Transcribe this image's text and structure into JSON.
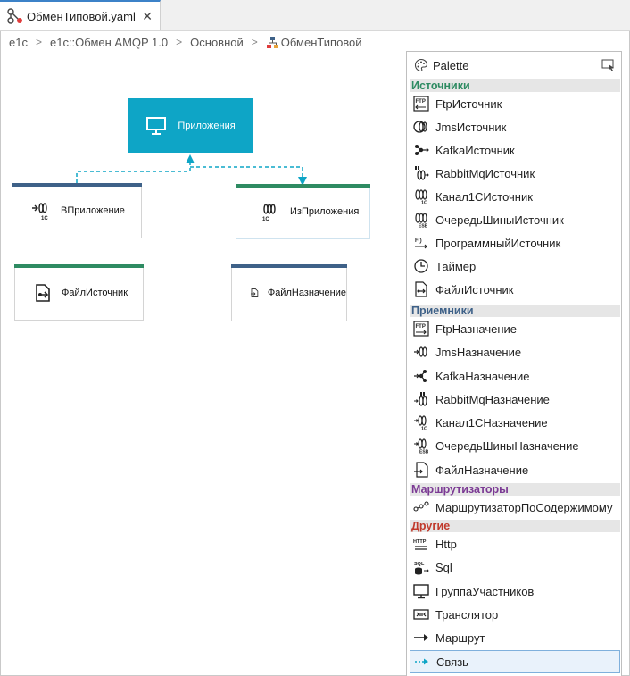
{
  "tab": {
    "title": "ОбменТиповой.yaml",
    "close": "✕"
  },
  "breadcrumb": [
    "e1c",
    "e1c::Обмен AMQP 1.0",
    "Основной",
    "ОбменТиповой"
  ],
  "colors": {
    "accent": "#0ea5c6",
    "source_bar": "#2e8b62",
    "target_bar": "#3e6188",
    "cat_sources": "#2e8b62",
    "cat_receivers": "#3e6188",
    "cat_routers": "#7b3a94",
    "cat_other": "#c0392b"
  },
  "diagram": {
    "app": "Приложения",
    "in_app": "ВПриложение",
    "from_app": "ИзПриложения",
    "file_source": "ФайлИсточник",
    "file_target": "ФайлНазначение"
  },
  "palette": {
    "title": "Palette",
    "categories": [
      {
        "name": "Источники",
        "items": [
          "FtpИсточник",
          "JmsИсточник",
          "KafkaИсточник",
          "RabbitMqИсточник",
          "Канал1СИсточник",
          "ОчередьШиныИсточник",
          "ПрограммныйИсточник",
          "Таймер",
          "ФайлИсточник"
        ]
      },
      {
        "name": "Приемники",
        "items": [
          "FtpНазначение",
          "JmsНазначение",
          "KafkaНазначение",
          "RabbitMqНазначение",
          "Канал1СНазначение",
          "ОчередьШиныНазначение",
          "ФайлНазначение"
        ]
      },
      {
        "name": "Маршрутизаторы",
        "items": [
          "МаршрутизаторПоСодержимому"
        ]
      },
      {
        "name": "Другие",
        "items": [
          "Http",
          "Sql",
          "ГруппаУчастников",
          "Транслятор",
          "Маршрут",
          "Связь"
        ]
      }
    ],
    "selected": "Связь"
  }
}
